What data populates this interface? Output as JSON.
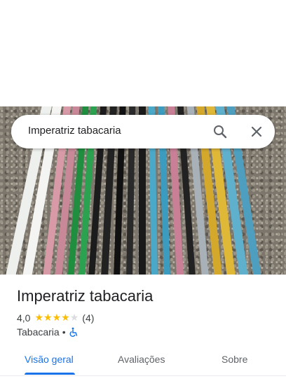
{
  "search": {
    "query": "Imperatriz tabacaria"
  },
  "place": {
    "name": "Imperatriz tabacaria",
    "rating_text": "4,0",
    "rating_value": 4,
    "rating_max": 5,
    "review_count": "(4)",
    "category": "Tabacaria",
    "separator": "•"
  },
  "tabs": [
    {
      "label": "Visão geral",
      "active": true
    },
    {
      "label": "Avaliações",
      "active": false
    },
    {
      "label": "Sobre",
      "active": false
    }
  ],
  "colors": {
    "accent": "#1a73e8",
    "star": "#fbbc04",
    "text": "#202124"
  },
  "icons": [
    "search-icon",
    "close-icon",
    "star-icon",
    "wheelchair-icon"
  ]
}
